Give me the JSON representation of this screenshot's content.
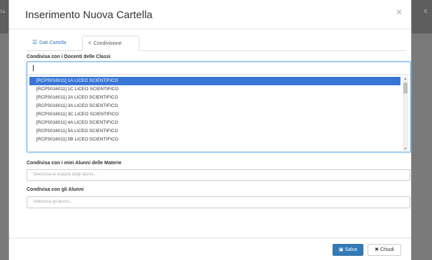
{
  "background": {
    "left_text": "LL",
    "right_text": "C"
  },
  "modal": {
    "title": "Inserimento Nuova Cartella",
    "close_glyph": "×"
  },
  "tabs": [
    {
      "label": "Dati Cartella",
      "icon": "list-icon",
      "active": false
    },
    {
      "label": "Condivisione",
      "icon": "share-icon",
      "active": true
    }
  ],
  "fields": {
    "docenti": {
      "label": "Condivisa con i Docenti delle Classi",
      "options": [
        "[RCPS016011] 1A LICEO SCIENTIFICO",
        "[RCPS016011] 1C LICEO SCIENTIFICO",
        "[RCPS016011] 2A LICEO SCIENTIFICO",
        "[RCPS016011] 3A LICEO SCIENTIFICO",
        "[RCPS016011] 3C LICEO SCIENTIFICO",
        "[RCPS016011] 4A LICEO SCIENTIFICO",
        "[RCPS016011] 5A LICEO SCIENTIFICO",
        "[RCPS016011] 5B LICEO SCIENTIFICO"
      ],
      "selected_index": 0
    },
    "materie": {
      "label": "Condivisa con i miei Alunni delle Materie",
      "placeholder": "Seleziona le materie degli alunni..."
    },
    "alunni": {
      "label": "Condivisa con gli Alunni",
      "placeholder": "Seleziona gli alunni..."
    }
  },
  "footer": {
    "save_label": "Salva",
    "close_label": "Chiudi"
  },
  "colors": {
    "primary": "#337ab7",
    "selected_option": "#3875d7",
    "focus_border": "#66afe9"
  }
}
